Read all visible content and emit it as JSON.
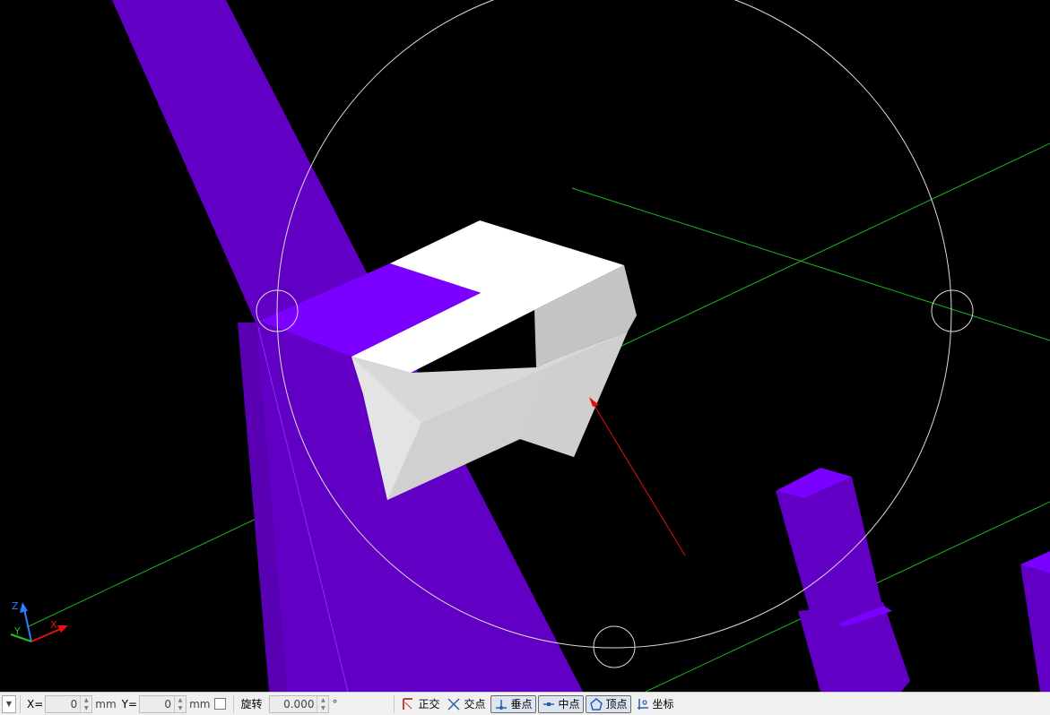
{
  "viewport": {
    "background": "#000000",
    "colors": {
      "purple_front": "#6100c4",
      "purple_top": "#7c00ff",
      "grey_light": "#d8d8d8",
      "grey_mid": "#c4c4c4",
      "white": "#ffffff",
      "green_axis": "#1cb51c",
      "red_arrow": "#e81010",
      "gizmo_circle": "#dcdcdc"
    },
    "axis_triad": {
      "z_label": "Z",
      "y_label": "Y",
      "x_label": "X"
    }
  },
  "statusbar": {
    "x_label": "X=",
    "x_value": "0",
    "y_label": "Y=",
    "y_value": "0",
    "unit": "mm",
    "rotate_label": "旋转",
    "rotate_value": "0.000",
    "degree_symbol": "°",
    "snap_tools": [
      {
        "label": "正交",
        "icon": "orthogonal-icon",
        "active": false
      },
      {
        "label": "交点",
        "icon": "intersection-icon",
        "active": false
      },
      {
        "label": "垂点",
        "icon": "perpendicular-icon",
        "active": true
      },
      {
        "label": "中点",
        "icon": "midpoint-icon",
        "active": true
      },
      {
        "label": "顶点",
        "icon": "vertex-icon",
        "active": true
      },
      {
        "label": "坐标",
        "icon": "coordinate-icon",
        "active": false
      }
    ]
  }
}
